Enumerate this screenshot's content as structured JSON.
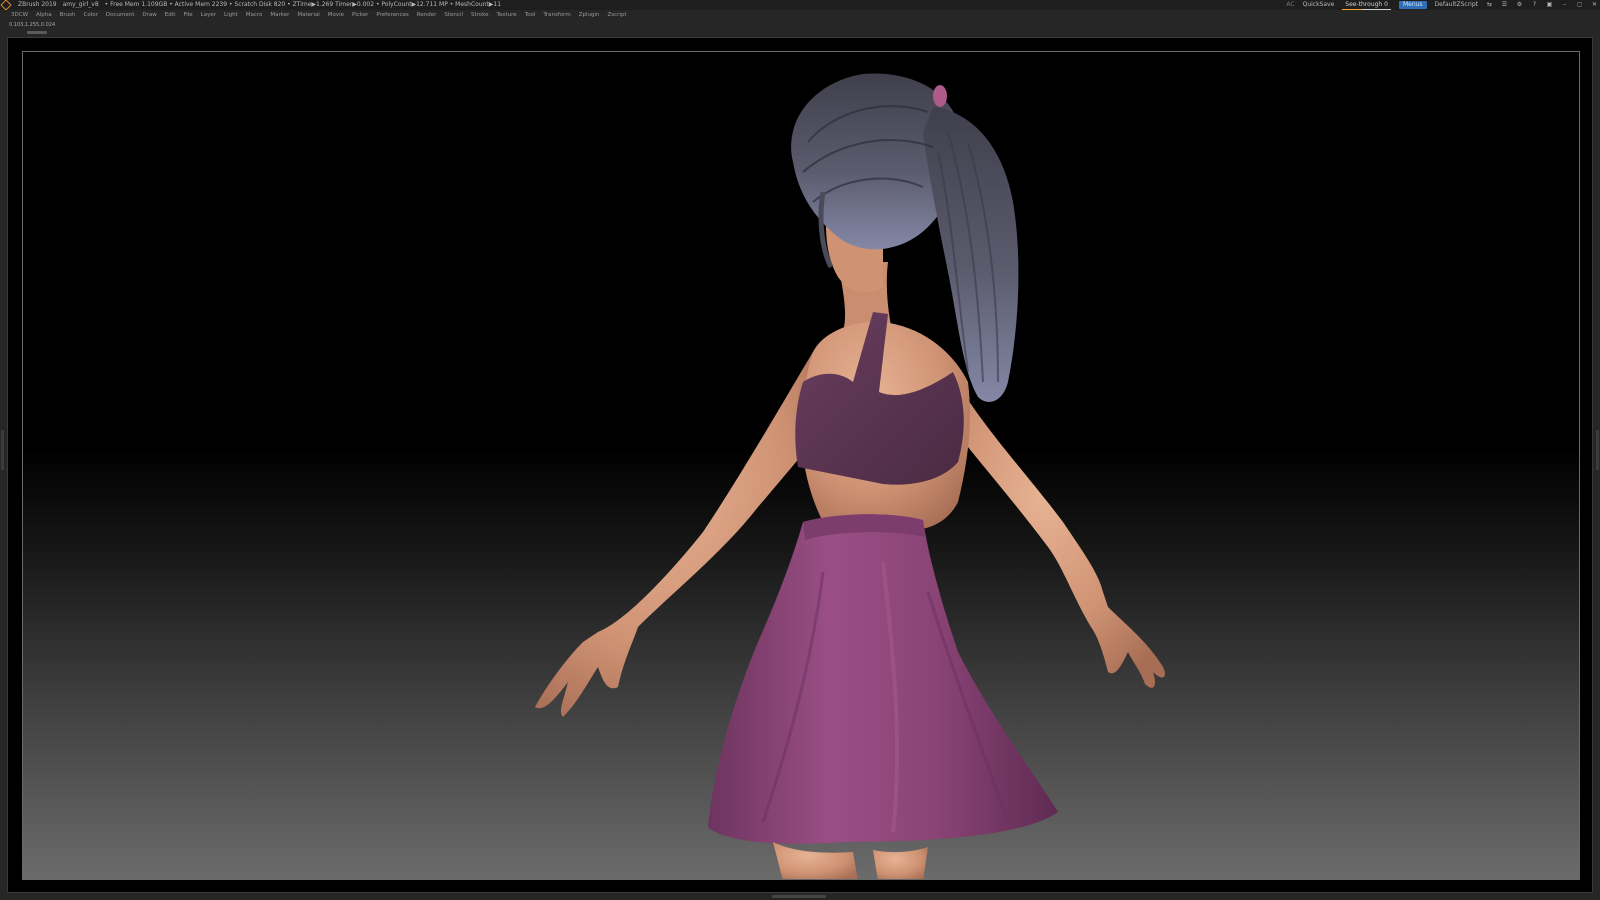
{
  "titlebar": {
    "app_name": "ZBrush 2019",
    "document": "amy_girl_v8",
    "stats": "• Free Mem 1.109GB • Active Mem 2239 • Scratch Disk 820 • ZTime▶1.269 Timer▶0.002 • PolyCount▶12.711 MP • MeshCount▶11",
    "ac": "AC",
    "quicksave": "QuickSave",
    "see_through": "See-through 0",
    "menus": "Menus",
    "script": "DefaultZScript"
  },
  "menubar": {
    "items": [
      "3DCW",
      "Alpha",
      "Brush",
      "Color",
      "Document",
      "Draw",
      "Edit",
      "File",
      "Layer",
      "Light",
      "Macro",
      "Marker",
      "Material",
      "Movie",
      "Picker",
      "Preferences",
      "Render",
      "Stencil",
      "Stroke",
      "Texture",
      "Tool",
      "Transform",
      "Zplugin",
      "Zscript"
    ]
  },
  "info": {
    "coords": "0.103,1.255,0.024"
  },
  "colors": {
    "skin": "#d49a7a",
    "top": "#55324c",
    "skirt": "#8c4577",
    "hair": "#4f4f5e",
    "hair_tie": "#b05a8a"
  }
}
